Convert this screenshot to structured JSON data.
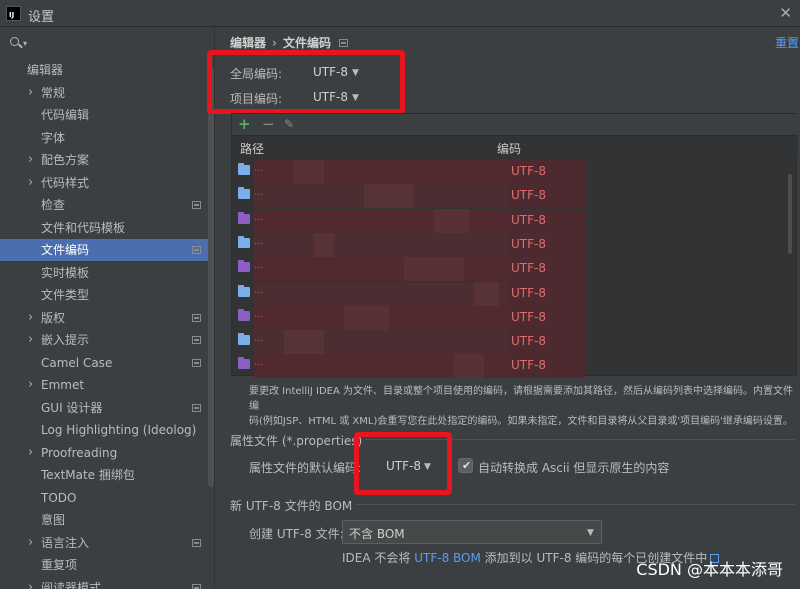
{
  "window": {
    "title": "设置"
  },
  "sidebar": {
    "items": [
      {
        "label": "编辑器",
        "indent": 0,
        "arrow": false,
        "badge": false,
        "selected": false
      },
      {
        "label": "常规",
        "indent": 1,
        "arrow": true,
        "badge": false,
        "selected": false
      },
      {
        "label": "代码编辑",
        "indent": 1,
        "arrow": false,
        "badge": false,
        "selected": false
      },
      {
        "label": "字体",
        "indent": 1,
        "arrow": false,
        "badge": false,
        "selected": false
      },
      {
        "label": "配色方案",
        "indent": 1,
        "arrow": true,
        "badge": false,
        "selected": false
      },
      {
        "label": "代码样式",
        "indent": 1,
        "arrow": true,
        "badge": false,
        "selected": false
      },
      {
        "label": "检查",
        "indent": 1,
        "arrow": false,
        "badge": true,
        "selected": false
      },
      {
        "label": "文件和代码模板",
        "indent": 1,
        "arrow": false,
        "badge": false,
        "selected": false
      },
      {
        "label": "文件编码",
        "indent": 1,
        "arrow": false,
        "badge": true,
        "selected": true
      },
      {
        "label": "实时模板",
        "indent": 1,
        "arrow": false,
        "badge": false,
        "selected": false
      },
      {
        "label": "文件类型",
        "indent": 1,
        "arrow": false,
        "badge": false,
        "selected": false
      },
      {
        "label": "版权",
        "indent": 1,
        "arrow": true,
        "badge": true,
        "selected": false
      },
      {
        "label": "嵌入提示",
        "indent": 1,
        "arrow": true,
        "badge": true,
        "selected": false
      },
      {
        "label": "Camel Case",
        "indent": 1,
        "arrow": false,
        "badge": true,
        "selected": false
      },
      {
        "label": "Emmet",
        "indent": 1,
        "arrow": true,
        "badge": false,
        "selected": false
      },
      {
        "label": "GUI 设计器",
        "indent": 1,
        "arrow": false,
        "badge": true,
        "selected": false
      },
      {
        "label": "Log Highlighting (Ideolog)",
        "indent": 1,
        "arrow": false,
        "badge": false,
        "selected": false
      },
      {
        "label": "Proofreading",
        "indent": 1,
        "arrow": true,
        "badge": false,
        "selected": false
      },
      {
        "label": "TextMate 捆绑包",
        "indent": 1,
        "arrow": false,
        "badge": false,
        "selected": false
      },
      {
        "label": "TODO",
        "indent": 1,
        "arrow": false,
        "badge": false,
        "selected": false
      },
      {
        "label": "意图",
        "indent": 1,
        "arrow": false,
        "badge": false,
        "selected": false
      },
      {
        "label": "语言注入",
        "indent": 1,
        "arrow": true,
        "badge": true,
        "selected": false
      },
      {
        "label": "重复项",
        "indent": 1,
        "arrow": false,
        "badge": false,
        "selected": false
      },
      {
        "label": "阅读器模式",
        "indent": 1,
        "arrow": true,
        "badge": true,
        "selected": false
      }
    ]
  },
  "breadcrumb": {
    "parent": "编辑器",
    "separator": "›",
    "current": "文件编码"
  },
  "reset_label": "重置",
  "global_encoding": {
    "label": "全局编码:",
    "value": "UTF-8"
  },
  "project_encoding": {
    "label": "项目编码:",
    "value": "UTF-8"
  },
  "table": {
    "columns": [
      "路径",
      "编码"
    ],
    "rows": [
      {
        "icon": "blue",
        "path": "...",
        "encoding": "UTF-8"
      },
      {
        "icon": "blue",
        "path": "...",
        "encoding": "UTF-8"
      },
      {
        "icon": "purple",
        "path": "...",
        "encoding": "UTF-8"
      },
      {
        "icon": "blue",
        "path": "...",
        "encoding": "UTF-8"
      },
      {
        "icon": "purple",
        "path": "...",
        "encoding": "UTF-8"
      },
      {
        "icon": "blue",
        "path": "...",
        "encoding": "UTF-8"
      },
      {
        "icon": "purple",
        "path": "...",
        "encoding": "UTF-8"
      },
      {
        "icon": "blue",
        "path": "...",
        "encoding": "UTF-8"
      },
      {
        "icon": "purple",
        "path": "...",
        "encoding": "UTF-8"
      }
    ]
  },
  "description": {
    "line1": "要更改 IntelliJ IDEA 为文件、目录或整个项目使用的编码，请根据需要添加其路径，然后从编码列表中选择编码。内置文件编",
    "line2": "码(例如JSP、HTML 或 XML)会重写您在此处指定的编码。如果未指定，文件和目录将从父目录或'项目编码'继承编码设置。"
  },
  "properties": {
    "section": "属性文件 (*.properties)",
    "default_label": "属性文件的默认编码:",
    "default_value": "UTF-8",
    "checkbox_label": "自动转换成 Ascii 但显示原生的内容",
    "checkbox_checked": true
  },
  "bom": {
    "section": "新 UTF-8 文件的 BOM",
    "create_label": "创建 UTF-8 文件:",
    "create_value": "不含 BOM",
    "note_prefix": "IDEA 不会将",
    "note_link": "UTF-8 BOM",
    "note_suffix": "添加到以 UTF-8 编码的每个已创建文件中"
  },
  "watermark": "CSDN @本本本添哥",
  "colors": {
    "background": "#3c3f41",
    "selection": "#4b6eaf",
    "link": "#589df6",
    "highlight_box": "#e8151e",
    "encoding_text": "#e06c6c"
  }
}
